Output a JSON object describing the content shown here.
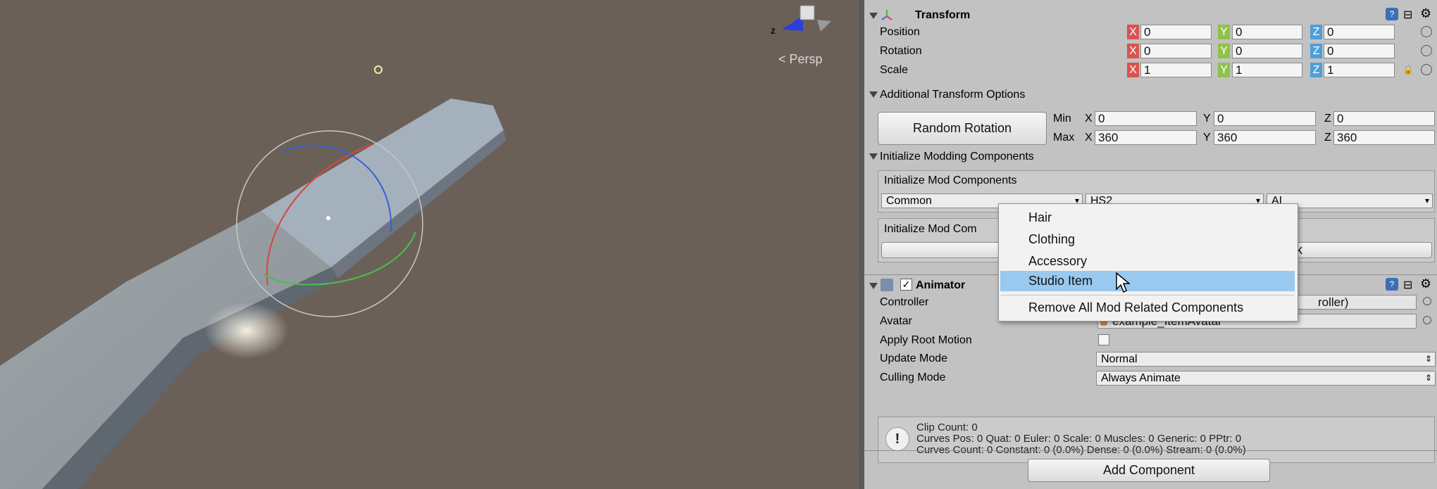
{
  "scene": {
    "persp_label": "< Persp",
    "gizmo_axis_label": "z"
  },
  "transform": {
    "title": "Transform",
    "rows": [
      {
        "label": "Position",
        "x": "0",
        "y": "0",
        "z": "0"
      },
      {
        "label": "Rotation",
        "x": "0",
        "y": "0",
        "z": "0"
      },
      {
        "label": "Scale",
        "x": "1",
        "y": "1",
        "z": "1"
      }
    ],
    "axis_x": "X",
    "axis_y": "Y",
    "axis_z": "Z"
  },
  "additional": {
    "title": "Additional Transform Options",
    "random_rotation_label": "Random Rotation",
    "min_label": "Min",
    "max_label": "Max",
    "min": {
      "x": "0",
      "y": "0",
      "z": "0"
    },
    "max": {
      "x": "360",
      "y": "360",
      "z": "360"
    },
    "x_label": "X",
    "y_label": "Y",
    "z_label": "Z"
  },
  "init": {
    "title": "Initialize Modding Components",
    "box1_title": "Initialize Mod Components",
    "dropdown1": "Common",
    "dropdown2": "HS2",
    "dropdown3": "AI",
    "box2_title": "Initialize Mod Com",
    "box2_btn_right": "ck"
  },
  "popup": {
    "items": [
      "Hair",
      "Clothing",
      "Accessory",
      "Studio Item"
    ],
    "selected": "Studio Item",
    "remove_label": "Remove All Mod Related Components"
  },
  "animator": {
    "title": "Animator",
    "controller_label": "Controller",
    "controller_value": "roller)",
    "avatar_label": "Avatar",
    "avatar_value": "example_ItemAvatar",
    "apply_root_motion_label": "Apply Root Motion",
    "update_mode_label": "Update Mode",
    "update_mode_value": "Normal",
    "culling_mode_label": "Culling Mode",
    "culling_mode_value": "Always Animate",
    "info_line1": "Clip Count: 0",
    "info_line2": "Curves Pos: 0 Quat: 0 Euler: 0 Scale: 0 Muscles: 0 Generic: 0 PPtr: 0",
    "info_line3": "Curves Count: 0 Constant: 0 (0.0%) Dense: 0 (0.0%) Stream: 0 (0.0%)"
  },
  "add_component_label": "Add Component"
}
